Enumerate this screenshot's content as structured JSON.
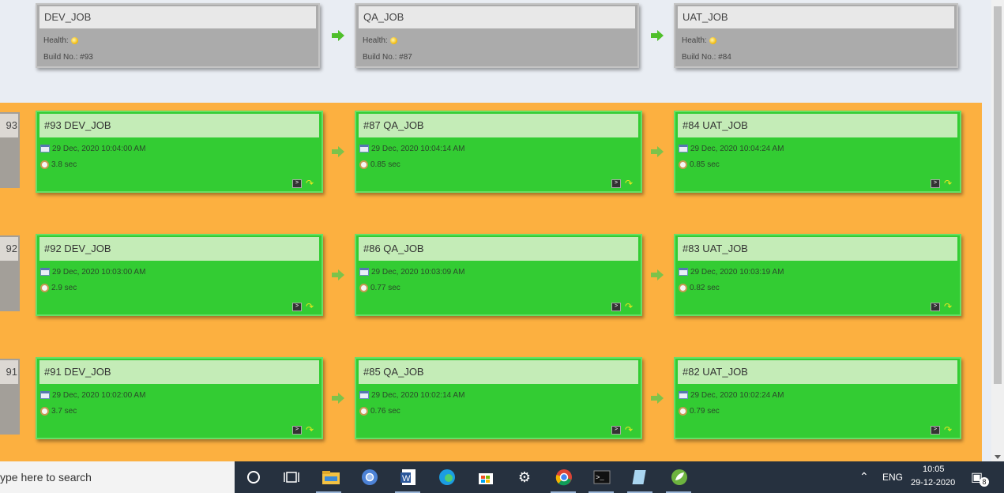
{
  "header_jobs": [
    {
      "name": "DEV_JOB",
      "health_label": "Health:",
      "build_label": "Build No.:",
      "build_no": "#93"
    },
    {
      "name": "QA_JOB",
      "health_label": "Health:",
      "build_label": "Build No.:",
      "build_no": "#87"
    },
    {
      "name": "UAT_JOB",
      "health_label": "Health:",
      "build_label": "Build No.:",
      "build_no": "#84"
    }
  ],
  "pipeline_rows": [
    {
      "side_number": "93",
      "builds": [
        {
          "title": "#93 DEV_JOB",
          "datetime": "29 Dec, 2020 10:04:00 AM",
          "duration": "3.8 sec"
        },
        {
          "title": "#87 QA_JOB",
          "datetime": "29 Dec, 2020 10:04:14 AM",
          "duration": "0.85 sec"
        },
        {
          "title": "#84 UAT_JOB",
          "datetime": "29 Dec, 2020 10:04:24 AM",
          "duration": "0.85 sec"
        }
      ]
    },
    {
      "side_number": "92",
      "builds": [
        {
          "title": "#92 DEV_JOB",
          "datetime": "29 Dec, 2020 10:03:00 AM",
          "duration": "2.9 sec"
        },
        {
          "title": "#86 QA_JOB",
          "datetime": "29 Dec, 2020 10:03:09 AM",
          "duration": "0.77 sec"
        },
        {
          "title": "#83 UAT_JOB",
          "datetime": "29 Dec, 2020 10:03:19 AM",
          "duration": "0.82 sec"
        }
      ]
    },
    {
      "side_number": "91",
      "builds": [
        {
          "title": "#91 DEV_JOB",
          "datetime": "29 Dec, 2020 10:02:00 AM",
          "duration": "3.7 sec"
        },
        {
          "title": "#85 QA_JOB",
          "datetime": "29 Dec, 2020 10:02:14 AM",
          "duration": "0.76 sec"
        },
        {
          "title": "#82 UAT_JOB",
          "datetime": "29 Dec, 2020 10:02:24 AM",
          "duration": "0.79 sec"
        }
      ]
    }
  ],
  "taskbar": {
    "search_placeholder": "ype here to search",
    "language": "ENG",
    "time": "10:05",
    "date": "29-12-2020",
    "notification_count": "8",
    "apps": [
      "cortana-icon",
      "task-view-icon",
      "file-explorer-icon",
      "chromium-icon",
      "word-icon",
      "edge-icon",
      "store-icon",
      "settings-icon",
      "chrome-icon",
      "terminal-icon",
      "notepad-icon",
      "spring-icon"
    ]
  },
  "colors": {
    "success_card": "#33cc33",
    "stage_background": "#fcb040",
    "header_card": "#ababab"
  }
}
